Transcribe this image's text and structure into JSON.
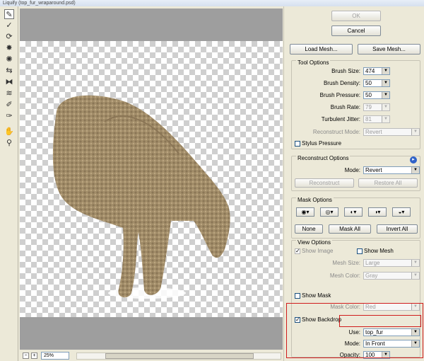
{
  "window": {
    "title": "Liquify (top_fur_wraparound.psd)"
  },
  "tools": [
    {
      "icon": "forward-warp-tool-icon",
      "glyph": "✎"
    },
    {
      "icon": "reconstruct-tool-icon",
      "glyph": "✓"
    },
    {
      "icon": "twirl-tool-icon",
      "glyph": "⟳"
    },
    {
      "icon": "pucker-tool-icon",
      "glyph": "✸"
    },
    {
      "icon": "bloat-tool-icon",
      "glyph": "✺"
    },
    {
      "icon": "push-left-tool-icon",
      "glyph": "⇆"
    },
    {
      "icon": "mirror-tool-icon",
      "glyph": "⧓"
    },
    {
      "icon": "turbulence-tool-icon",
      "glyph": "≋"
    },
    {
      "icon": "freeze-mask-tool-icon",
      "glyph": "✐"
    },
    {
      "icon": "thaw-mask-tool-icon",
      "glyph": "✑"
    },
    {
      "icon": "hand-tool-icon",
      "glyph": "✋"
    },
    {
      "icon": "zoom-tool-icon",
      "glyph": "⚲"
    }
  ],
  "status": {
    "zoom": "25%",
    "zoom_out": "−",
    "zoom_in": "+"
  },
  "buttons": {
    "ok": "OK",
    "cancel": "Cancel",
    "load_mesh": "Load Mesh...",
    "save_mesh": "Save Mesh..."
  },
  "tool_options": {
    "title": "Tool Options",
    "brush_size_label": "Brush Size:",
    "brush_size": "474",
    "brush_density_label": "Brush Density:",
    "brush_density": "50",
    "brush_pressure_label": "Brush Pressure:",
    "brush_pressure": "50",
    "brush_rate_label": "Brush Rate:",
    "brush_rate": "79",
    "turbulent_jitter_label": "Turbulent Jitter:",
    "turbulent_jitter": "81",
    "reconstruct_mode_label": "Reconstruct Mode:",
    "reconstruct_mode": "Revert",
    "stylus_pressure_label": "Stylus Pressure"
  },
  "reconstruct_options": {
    "title": "Reconstruct Options",
    "mode_label": "Mode:",
    "mode": "Revert",
    "reconstruct_button": "Reconstruct",
    "restore_all_button": "Restore All"
  },
  "mask_options": {
    "title": "Mask Options",
    "none_button": "None",
    "mask_all_button": "Mask All",
    "invert_all_button": "Invert All"
  },
  "view_options": {
    "title": "View Options",
    "show_image_label": "Show Image",
    "show_mesh_label": "Show Mesh",
    "mesh_size_label": "Mesh Size:",
    "mesh_size": "Large",
    "mesh_color_label": "Mesh Color:",
    "mesh_color": "Gray",
    "show_mask_label": "Show Mask",
    "mask_color_label": "Mask Color:",
    "mask_color": "Red",
    "show_backdrop_label": "Show Backdrop",
    "use_label": "Use:",
    "use": "top_fur",
    "backdrop_mode_label": "Mode:",
    "backdrop_mode": "In Front",
    "opacity_label": "Opacity:",
    "opacity": "100"
  },
  "colors": {
    "highlight": "#d01c1c",
    "canvas_bg": "#9e9e9e",
    "fur": "#a38e6a"
  }
}
